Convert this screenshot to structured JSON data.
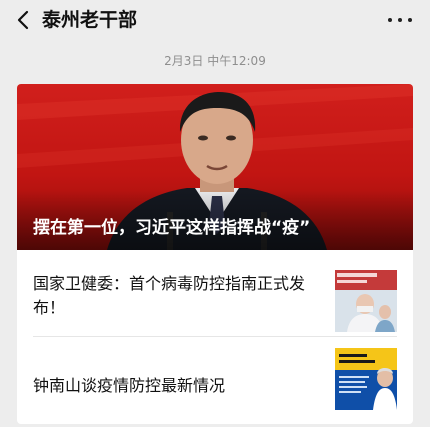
{
  "header": {
    "title": "泰州老干部"
  },
  "message": {
    "timestamp": "2月3日 中午12:09"
  },
  "article_card": {
    "main": {
      "title": "摆在第一位，习近平这样指挥战“疫”"
    },
    "items": [
      {
        "title": "国家卫健委：首个病毒防控指南正式发布！"
      },
      {
        "title": "钟南山谈疫情防控最新情况"
      }
    ]
  }
}
